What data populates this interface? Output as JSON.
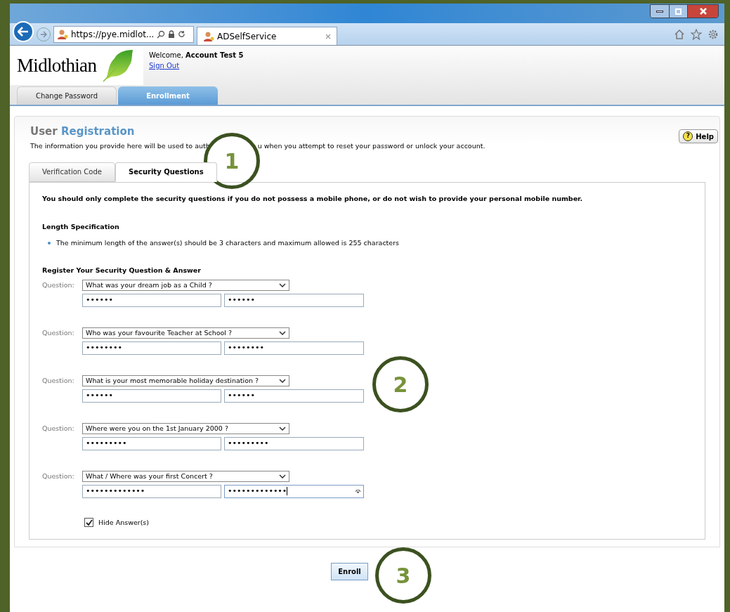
{
  "browser": {
    "address": "https://pye.midlot...",
    "tab_title": "ADSelfService"
  },
  "header": {
    "logo_text": "Midlothian",
    "welcome_prefix": "Welcome,",
    "user": "Account Test 5",
    "sign_out": "Sign Out"
  },
  "nav_tabs": [
    {
      "label": "Change Password",
      "selected": false
    },
    {
      "label": "Enrollment",
      "selected": true
    }
  ],
  "page": {
    "title_part1": "User",
    "title_part2": "Registration",
    "description_before": "The information you provide here will be used to auth",
    "description_after": "u when you attempt to reset your password or unlock your account.",
    "help": "Help",
    "help_icon": "?"
  },
  "sub_tabs": [
    {
      "label": "Verification Code",
      "selected": false
    },
    {
      "label": "Security Questions",
      "selected": true
    }
  ],
  "notice": "You should only complete the security questions if you do not possess a mobile phone, or do not wish to provide your personal mobile number.",
  "length_spec": {
    "heading": "Length Specification",
    "rule": "The minimum length of the answer(s) should be 3 characters and maximum allowed is 255 characters"
  },
  "register_heading": "Register Your Security Question & Answer",
  "questions": [
    {
      "label": "Question:",
      "question": "What was your dream job as a Child ?",
      "answer": "••••••",
      "confirm": "••••••",
      "focused": false
    },
    {
      "label": "Question:",
      "question": "Who was your favourite Teacher at School ?",
      "answer": "••••••••",
      "confirm": "••••••••",
      "focused": false
    },
    {
      "label": "Question:",
      "question": "What is your most memorable holiday destination ?",
      "answer": "••••••",
      "confirm": "••••••",
      "focused": false
    },
    {
      "label": "Question:",
      "question": "Where were you on the 1st January 2000 ?",
      "answer": "•••••••••",
      "confirm": "•••••••••",
      "focused": false
    },
    {
      "label": "Question:",
      "question": "What / Where was your first Concert ?",
      "answer": "•••••••••••••",
      "confirm": "•••••••••••••",
      "focused": true
    }
  ],
  "hide_answers": {
    "label": "Hide Answer(s)",
    "checked": true
  },
  "enroll": "Enroll",
  "callouts": [
    "1",
    "2",
    "3"
  ]
}
